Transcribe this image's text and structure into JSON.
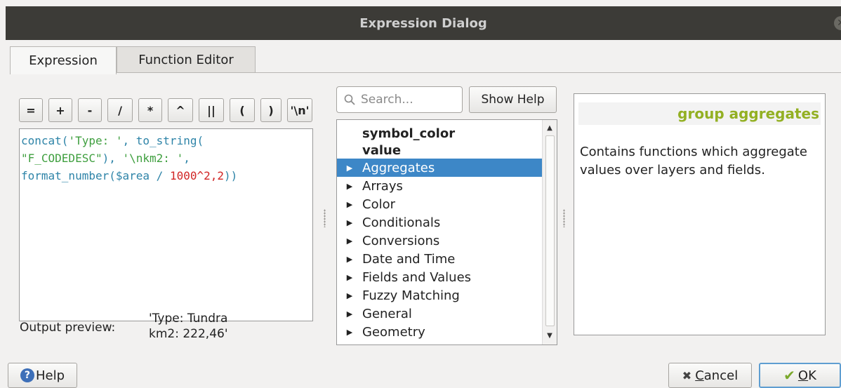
{
  "window": {
    "title": "Expression Dialog"
  },
  "tabs": [
    {
      "label": "Expression"
    },
    {
      "label": "Function Editor"
    }
  ],
  "operators": [
    "=",
    "+",
    "-",
    "/",
    "*",
    "^",
    "||",
    "(",
    ")",
    "'\\n'"
  ],
  "editor": {
    "line1": [
      "concat(",
      "'Type: '",
      ", ",
      "to_string("
    ],
    "line2": [
      "\"F_CODEDESC\"",
      "), ",
      "'\\nkm2: '",
      ","
    ],
    "line3": [
      "format_number(",
      "$area",
      " / ",
      "1000^2,2",
      "))"
    ]
  },
  "output_preview": {
    "label": "Output preview:",
    "value": "'Type: Tundra\nkm2: 222,46'"
  },
  "search": {
    "placeholder": "Search..."
  },
  "show_help_button": "Show Help",
  "tree": {
    "items": [
      {
        "label": "symbol_color",
        "type": "field"
      },
      {
        "label": "value",
        "type": "field"
      },
      {
        "label": "Aggregates",
        "type": "group",
        "selected": true
      },
      {
        "label": "Arrays",
        "type": "group"
      },
      {
        "label": "Color",
        "type": "group"
      },
      {
        "label": "Conditionals",
        "type": "group"
      },
      {
        "label": "Conversions",
        "type": "group"
      },
      {
        "label": "Date and Time",
        "type": "group"
      },
      {
        "label": "Fields and Values",
        "type": "group"
      },
      {
        "label": "Fuzzy Matching",
        "type": "group"
      },
      {
        "label": "General",
        "type": "group"
      },
      {
        "label": "Geometry",
        "type": "group"
      }
    ]
  },
  "help_panel": {
    "title": "group aggregates",
    "body": "Contains functions which aggregate values over layers and fields."
  },
  "buttons": {
    "help": "Help",
    "cancel_pre": "",
    "cancel_u": "C",
    "cancel_post": "ancel",
    "ok_u": "O",
    "ok_post": "K"
  },
  "colors": {
    "title_bar": "#3c3b37",
    "selection": "#3d87c7",
    "help_title": "#93b023"
  }
}
